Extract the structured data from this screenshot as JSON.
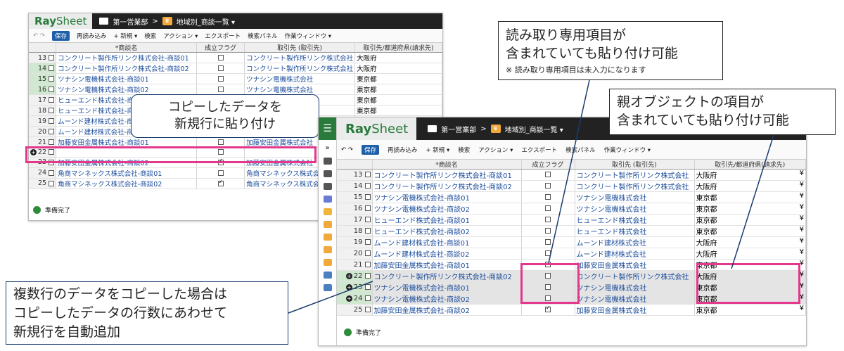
{
  "back_window": {
    "brand_ray": "Ray",
    "brand_sheet": "Sheet",
    "breadcrumb_folder": "第一営業部",
    "breadcrumb_sep": ">",
    "breadcrumb_view": "地域別_商談一覧 ▾",
    "toolbar": {
      "undo": "↶ ↷",
      "save": "保存",
      "reload": "再読み込み",
      "new": "+ 新規 ▾",
      "search": "検索",
      "action": "アクション ▾",
      "export": "エクスポート",
      "search_panel": "検索パネル",
      "work_window": "作業ウィンドウ ▾"
    },
    "columns": [
      "*商談名",
      "成立フラグ",
      "取引先 (取引先)",
      "取引先/都道府県(請求先)"
    ],
    "rows": [
      {
        "no": "13",
        "name": "コンクリート製作所リンク株式会社-商談01",
        "flag": false,
        "account": "コンクリート製作所リンク株式会社",
        "pref": "大阪府"
      },
      {
        "no": "14",
        "name": "コンクリート製作所リンク株式会社-商談02",
        "flag": false,
        "account": "コンクリート製作所リンク株式会社",
        "pref": "大阪府"
      },
      {
        "no": "15",
        "name": "ツナシン電機株式会社-商談01",
        "flag": false,
        "account": "ツナシン電機株式会社",
        "pref": "東京都"
      },
      {
        "no": "16",
        "name": "ツナシン電機株式会社-商談02",
        "flag": false,
        "account": "ツナシン電機株式会社",
        "pref": "東京都"
      },
      {
        "no": "17",
        "name": "ヒューエンド株式会社-商談01",
        "flag": false,
        "account": "",
        "pref": "東京都"
      },
      {
        "no": "18",
        "name": "ヒューエンド株式会社-商談02",
        "flag": false,
        "account": "",
        "pref": "東京都"
      },
      {
        "no": "19",
        "name": "ムーンド建材株式会社-商談01",
        "flag": false,
        "account": "",
        "pref": "大阪府"
      },
      {
        "no": "20",
        "name": "ムーンド建材株式会社-商談02",
        "flag": false,
        "account": "",
        "pref": "大阪府"
      },
      {
        "no": "21",
        "name": "加藤安田金属株式会社-商談01",
        "flag": false,
        "account": "加藤安田金属株式会社",
        "pref": ""
      },
      {
        "no": "22",
        "name": "",
        "flag": false,
        "account": "",
        "pref": ""
      },
      {
        "no": "23",
        "name": "加藤安田金属株式会社-商談02",
        "flag": true,
        "account": "加藤安田金属株式会社",
        "pref": "東京都"
      },
      {
        "no": "24",
        "name": "角商マシネックス株式会社-商談01",
        "flag": false,
        "account": "角商マシネックス株式会社",
        "pref": "東京都"
      },
      {
        "no": "25",
        "name": "角商マシネックス株式会社-商談02",
        "flag": true,
        "account": "角商マシネックス株式会社",
        "pref": "東京都"
      }
    ],
    "status": "準備完了"
  },
  "front_window": {
    "brand_ray": "Ray",
    "brand_sheet": "Sheet",
    "breadcrumb_folder": "第一営業部",
    "breadcrumb_sep": ">",
    "breadcrumb_view": "地域別_商談一覧 ▾",
    "collapse": "»",
    "toolbar": {
      "undo": "↶ ↷",
      "save": "保存",
      "reload": "再読み込み",
      "new": "+ 新規 ▾",
      "search": "検索",
      "action": "アクション ▾",
      "export": "エクスポート",
      "search_panel": "検索パネル",
      "work_window": "作業ウィンドウ ▾"
    },
    "columns": [
      "*商談名",
      "成立フラグ",
      "取引先 (取引先)",
      "取引先/都道府県(請求先)"
    ],
    "rows": [
      {
        "no": "13",
        "name": "コンクリート製作所リンク株式会社-商談01",
        "flag": false,
        "account": "コンクリート製作所リンク株式会社",
        "pref": "大阪府"
      },
      {
        "no": "14",
        "name": "コンクリート製作所リンク株式会社-商談02",
        "flag": false,
        "account": "コンクリート製作所リンク株式会社",
        "pref": "大阪府"
      },
      {
        "no": "15",
        "name": "ツナシン電機株式会社-商談01",
        "flag": false,
        "account": "ツナシン電機株式会社",
        "pref": "東京都"
      },
      {
        "no": "16",
        "name": "ツナシン電機株式会社-商談02",
        "flag": false,
        "account": "ツナシン電機株式会社",
        "pref": "東京都"
      },
      {
        "no": "17",
        "name": "ヒューエンド株式会社-商談01",
        "flag": false,
        "account": "ヒューエンド株式会社",
        "pref": "東京都"
      },
      {
        "no": "18",
        "name": "ヒューエンド株式会社-商談02",
        "flag": false,
        "account": "ヒューエンド株式会社",
        "pref": "東京都"
      },
      {
        "no": "19",
        "name": "ムーンド建材株式会社-商談01",
        "flag": false,
        "account": "ムーンド建材株式会社",
        "pref": "大阪府"
      },
      {
        "no": "20",
        "name": "ムーンド建材株式会社-商談02",
        "flag": false,
        "account": "ムーンド建材株式会社",
        "pref": "大阪府"
      },
      {
        "no": "21",
        "name": "加藤安田金属株式会社-商談01",
        "flag": false,
        "account": "加藤安田金属株式会社",
        "pref": "東京都"
      },
      {
        "no": "22",
        "name": "コンクリート製作所リンク株式会社-商談02",
        "flag": false,
        "account": "コンクリート製作所リンク株式会社",
        "pref": "大阪府",
        "new": true
      },
      {
        "no": "23",
        "name": "ツナシン電機株式会社-商談01",
        "flag": false,
        "account": "ツナシン電機株式会社",
        "pref": "東京都",
        "new": true
      },
      {
        "no": "24",
        "name": "ツナシン電機株式会社-商談02",
        "flag": false,
        "account": "ツナシン電機株式会社",
        "pref": "東京都",
        "new": true
      },
      {
        "no": "25",
        "name": "加藤安田金属株式会社-商談02",
        "flag": true,
        "account": "加藤安田金属株式会社",
        "pref": "東京都"
      }
    ],
    "currency": "¥",
    "status": "準備完了"
  },
  "callouts": {
    "copy_new_row": "コピーしたデータを\n新規行に貼り付け",
    "readonly_title": "読み取り専用項目が\n含まれていても貼り付け可能",
    "readonly_note": "※ 読み取り専用項目は未入力になります",
    "parent_title": "親オブジェクトの項目が\n含まれていても貼り付け可能",
    "multi_row": "複数行のデータをコピーした場合は\nコピーしたデータの行数にあわせて\n新規行を自動追加"
  },
  "colors": {
    "brand_green": "#2b7a3d",
    "highlight_pink": "#e4388c",
    "topbar": "#222222",
    "link": "#1c4d9c"
  }
}
